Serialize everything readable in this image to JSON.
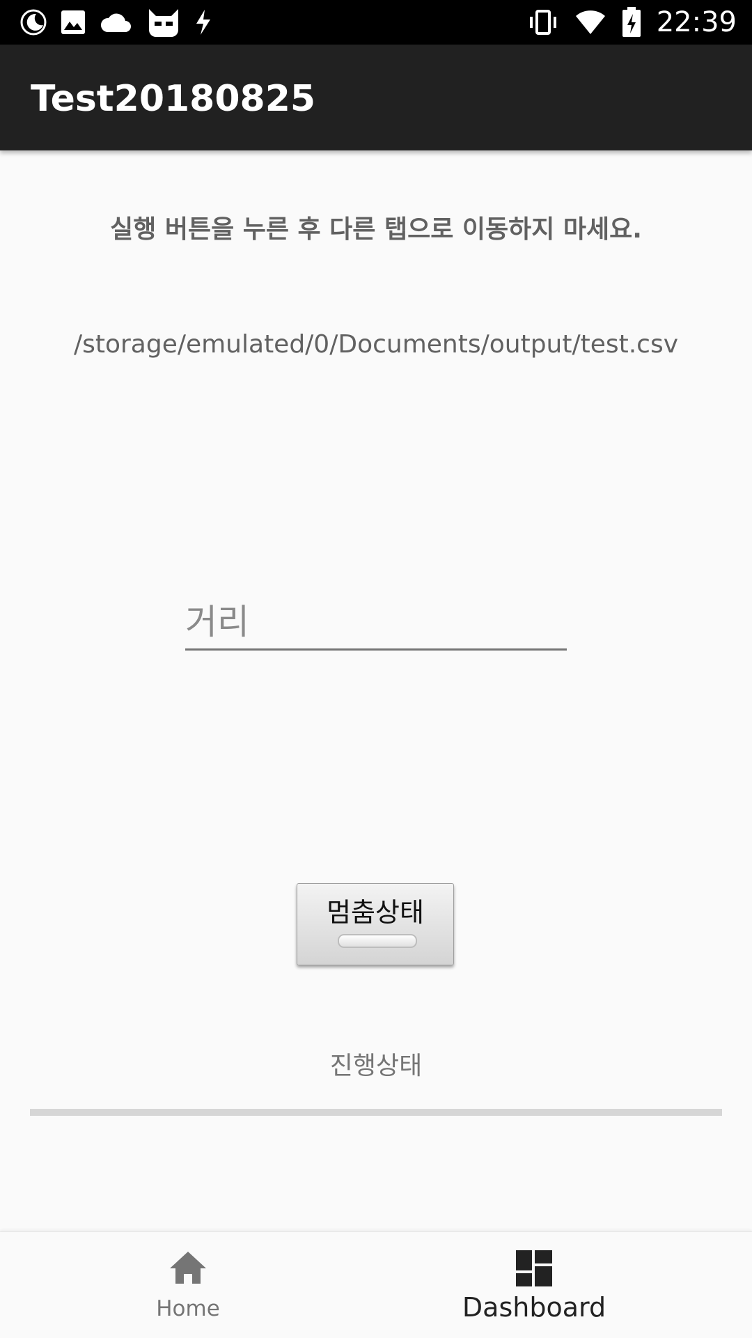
{
  "status_bar": {
    "time": "22:39",
    "icons_left": [
      "moon-icon",
      "image-icon",
      "cloud-icon",
      "cat-icon",
      "lightning-icon"
    ],
    "icons_right": [
      "vibrate-icon",
      "wifi-icon",
      "battery-charging-icon"
    ]
  },
  "app_bar": {
    "title": "Test20180825"
  },
  "main": {
    "instruction": "실행 버튼을 누른 후 다른 탭으로 이동하지 마세요.",
    "file_path": "/storage/emulated/0/Documents/output/test.csv",
    "distance_placeholder": "거리",
    "distance_value": "",
    "stop_button_label": "멈춤상태",
    "progress_label": "진행상태",
    "progress_fraction": 0
  },
  "bottom_nav": {
    "items": [
      {
        "label": "Home",
        "icon": "home-icon",
        "selected": false
      },
      {
        "label": "Dashboard",
        "icon": "dashboard-icon",
        "selected": true
      }
    ]
  },
  "colors": {
    "app_bar": "#212121",
    "background": "#fafafa",
    "text_secondary": "#616161"
  }
}
